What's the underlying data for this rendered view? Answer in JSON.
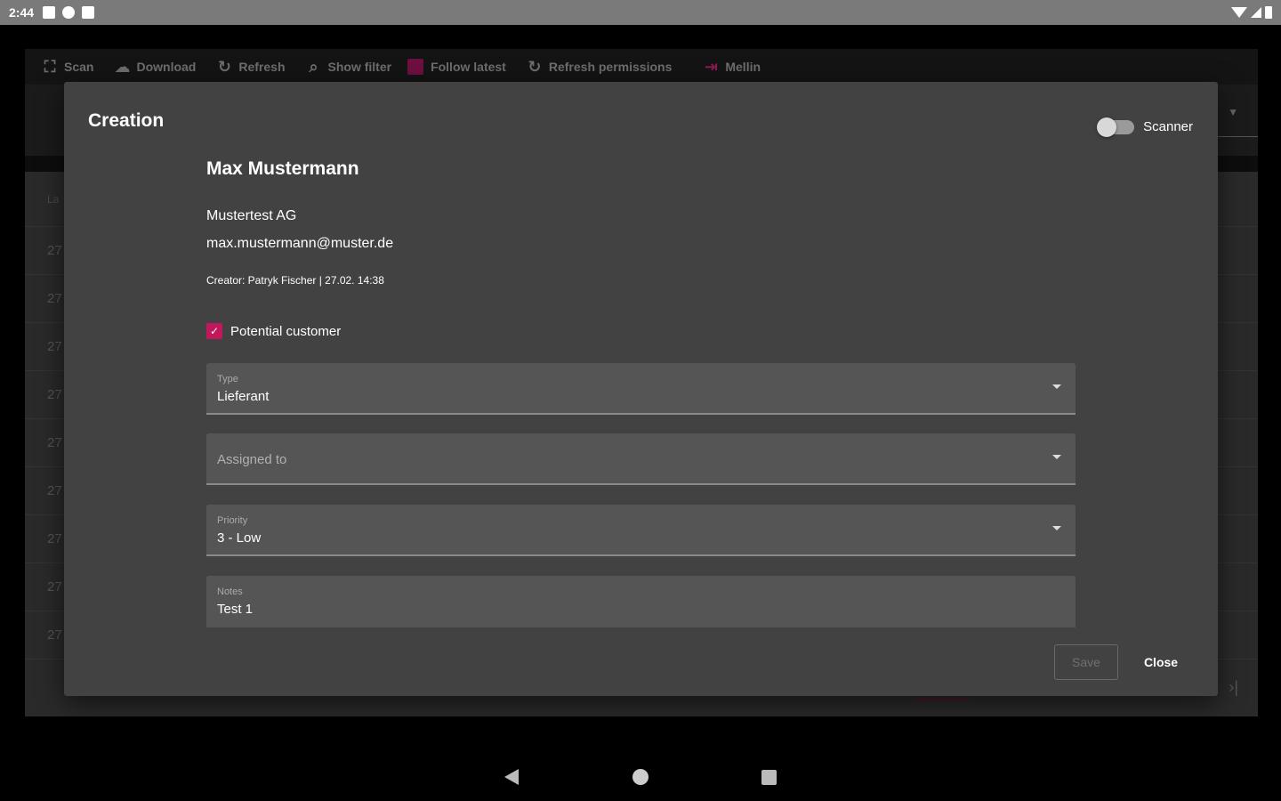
{
  "status_bar": {
    "time": "2:44"
  },
  "toolbar": {
    "items": [
      {
        "label": "Scan",
        "icon": "scan-icon"
      },
      {
        "label": "Download",
        "icon": "cloud-download-icon"
      },
      {
        "label": "Refresh",
        "icon": "refresh-icon"
      },
      {
        "label": "Show filter",
        "icon": "search-icon"
      },
      {
        "label": "Follow latest",
        "icon": "checkbox-icon"
      },
      {
        "label": "Refresh permissions",
        "icon": "refresh-icon"
      },
      {
        "label": "Mellin",
        "icon": "logout-icon"
      }
    ]
  },
  "background_table": {
    "header": "La",
    "rows": [
      "27",
      "27",
      "27",
      "27",
      "27",
      "27",
      "27",
      "27",
      "27"
    ]
  },
  "dialog": {
    "title": "Creation",
    "scanner_label": "Scanner",
    "scanner_on": false,
    "contact": {
      "name": "Max Mustermann",
      "company": "Mustertest AG",
      "email": "max.mustermann@muster.de",
      "creator": "Creator: Patryk Fischer | 27.02. 14:38"
    },
    "potential_customer": {
      "label": "Potential customer",
      "checked": true
    },
    "fields": {
      "type": {
        "label": "Type",
        "value": "Lieferant"
      },
      "assigned": {
        "placeholder": "Assigned to"
      },
      "priority": {
        "label": "Priority",
        "value": "3 - Low"
      },
      "notes": {
        "label": "Notes",
        "value": "Test 1"
      }
    },
    "save_label": "Save",
    "close_label": "Close"
  },
  "colors": {
    "accent": "#c2185b",
    "dialog_bg": "#424242",
    "field_bg": "#555555"
  }
}
